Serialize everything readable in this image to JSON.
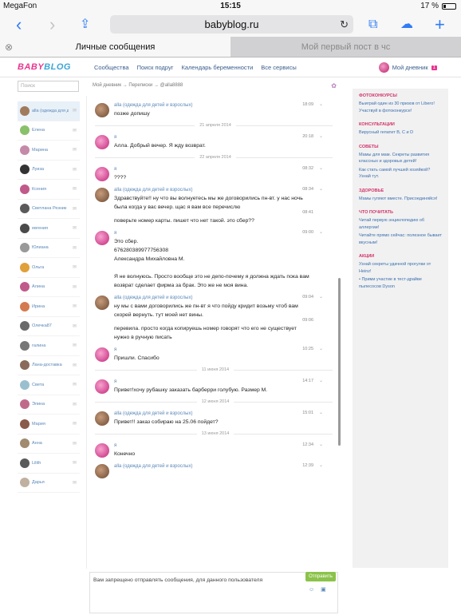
{
  "status": {
    "carrier": "MegaFon",
    "time": "15:15",
    "battery": "17 %"
  },
  "browser": {
    "url": "babyblog.ru",
    "tabs": [
      {
        "label": "Личные сообщения",
        "active": true
      },
      {
        "label": "Мой первый пост в чс",
        "active": false
      }
    ]
  },
  "site": {
    "logo_a": "BABY",
    "logo_b": "BLOG",
    "nav": [
      "Сообщества",
      "Поиск подруг",
      "Календарь беременности",
      "Все сервисы"
    ],
    "my_diary": "Мой дневник",
    "badge": "1"
  },
  "search_placeholder": "Поиск",
  "contacts": [
    "alla (одежда для детей и взрослых)",
    "Елена",
    "Марина",
    "Луиза",
    "Ксения",
    "Светлана Резник",
    "евгения",
    "Юлиана",
    "Ольга",
    "Алина",
    "Ирина",
    "Олечка87",
    "галина",
    "Лана-доставка",
    "Света",
    "Элина",
    "Мария",
    "Анна",
    "Lilith",
    "Дарья"
  ],
  "breadcrumb": "Мой дневник → Переписки → @alla8888",
  "messages": [
    {
      "author": "alla (одежда для детей и взрослых)",
      "time": "18:09",
      "text": "позже допишу",
      "avatar": "brown"
    },
    {
      "sep": "21 апреля 2014"
    },
    {
      "author": "я",
      "time": "20:18",
      "text": "Алла. Добрый вечер. Я жду возврат.",
      "avatar": "pink"
    },
    {
      "sep": "22 апреля 2014"
    },
    {
      "author": "я",
      "time": "08:32",
      "text": "????",
      "avatar": "pink"
    },
    {
      "author": "alla (одежда для детей и взрослых)",
      "time": "08:34",
      "text": "Здравствуйте!! ну что вы волнуетесь мы же договорились пн-вт. у нас ночь была когда у вас вечер. щас я вам все перечислю",
      "avatar": "brown",
      "extra": {
        "time": "08:41",
        "text": "поверьте номер карты. пишет что нет такой. это сбер??"
      }
    },
    {
      "author": "я",
      "time": "09:00",
      "text": "Это сбер.\n676280389977756308\nАлександра Михайловна М.\n\nЯ не волнуюсь. Просто вообще это не депо-почему я должна ждать пока вам возврат сделает фирма за брак. Это же не моя вина.",
      "avatar": "pink"
    },
    {
      "author": "alla (одежда для детей и взрослых)",
      "time": "09:04",
      "text": "ну мы с вами договорились же пн-вт я что пойду кридит возьму чтоб вам скорей вернуть. тут моей нет вины.",
      "avatar": "brown",
      "extra": {
        "time": "09:06",
        "text": "перевила. просто когда копируешь номер говорят что его не существует нужно в ручную писать"
      }
    },
    {
      "author": "я",
      "time": "10:25",
      "text": "Пришли. Спасибо",
      "avatar": "pink"
    },
    {
      "sep": "11 июня 2014"
    },
    {
      "author": "я",
      "time": "14:17",
      "text": "Привет!хочу рубашку заказать барберри голубую. Размер М.",
      "avatar": "pink"
    },
    {
      "sep": "12 июня 2014"
    },
    {
      "author": "alla (одежда для детей и взрослых)",
      "time": "15:01",
      "text": "Привет!! заказ собираю на 25.06 пойдет?",
      "avatar": "brown"
    },
    {
      "sep": "13 июня 2014"
    },
    {
      "author": "я",
      "time": "12:34",
      "text": "Конечно",
      "avatar": "pink"
    },
    {
      "author": "alla (одежда для детей и взрослых)",
      "time": "12:39",
      "text": "",
      "avatar": "brown"
    }
  ],
  "compose": {
    "text": "Вам запрещено отправлять сообщения, для данного пользователя",
    "send": "Отправить"
  },
  "sidebar": [
    {
      "title": "ФОТОКОНКУРСЫ",
      "links": [
        "Выиграй один из 30 призов от Libero! Участвуй в фотоконкурсе!"
      ]
    },
    {
      "title": "КОНСУЛЬТАЦИИ",
      "links": [
        "Вирусный гепатит B, C и D"
      ]
    },
    {
      "title": "СОВЕТЫ",
      "links": [
        "Мамы для мам. Секреты развития классных и здоровых детей!",
        "Как стать самой лучшей хозяйкой? Узнай тут."
      ]
    },
    {
      "title": "ЗДОРОВЬЕ",
      "links": [
        "Мамы гуляют вместе. Присоединяйся!"
      ]
    },
    {
      "title": "ЧТО ПОЧИТАТЬ",
      "links": [
        "Читай первую энциклопедию об аллергии!",
        "Читайте прямо сейчас: полезное бывает вкусным!"
      ]
    },
    {
      "title": "АКЦИИ",
      "links": [
        "Узнай секреты удачной прогулки от Heinz!",
        "• Прими участие в тест-драйве пылесосов Dyson"
      ]
    }
  ]
}
